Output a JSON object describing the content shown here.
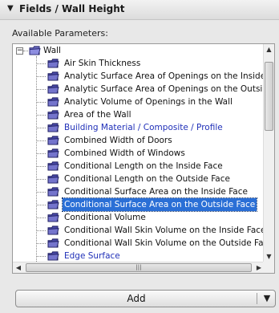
{
  "header": {
    "title": "Fields /  Wall Height"
  },
  "available_label": "Available Parameters:",
  "tree": {
    "root_label": "Wall",
    "expander": "−",
    "items": [
      {
        "label": "Air Skin Thickness",
        "style": "normal"
      },
      {
        "label": "Analytic Surface Area of Openings on the Inside Face",
        "style": "normal"
      },
      {
        "label": "Analytic Surface Area of Openings on the Outside Face",
        "style": "normal"
      },
      {
        "label": "Analytic Volume of Openings in the Wall",
        "style": "normal"
      },
      {
        "label": "Area of the Wall",
        "style": "normal"
      },
      {
        "label": "Building Material / Composite / Profile",
        "style": "blue"
      },
      {
        "label": "Combined Width of Doors",
        "style": "normal"
      },
      {
        "label": "Combined Width of Windows",
        "style": "normal"
      },
      {
        "label": "Conditional Length on the Inside Face",
        "style": "normal"
      },
      {
        "label": "Conditional Length on the Outside Face",
        "style": "normal"
      },
      {
        "label": "Conditional Surface Area on the Inside Face",
        "style": "normal"
      },
      {
        "label": "Conditional Surface Area on the Outside Face",
        "style": "selected"
      },
      {
        "label": "Conditional Volume",
        "style": "normal"
      },
      {
        "label": "Conditional Wall Skin Volume on the Inside Face",
        "style": "normal"
      },
      {
        "label": "Conditional Wall Skin Volume on the Outside Face",
        "style": "normal"
      },
      {
        "label": "Edge Surface",
        "style": "blue"
      }
    ]
  },
  "scrollbar": {
    "up": "▲",
    "down": "▼",
    "left": "◀",
    "right": "▶",
    "grip": "|||"
  },
  "add_button": {
    "label": "Add",
    "arrow": "▼"
  },
  "colors": {
    "selection": "#2a6fd6",
    "link_blue": "#2030b8"
  }
}
